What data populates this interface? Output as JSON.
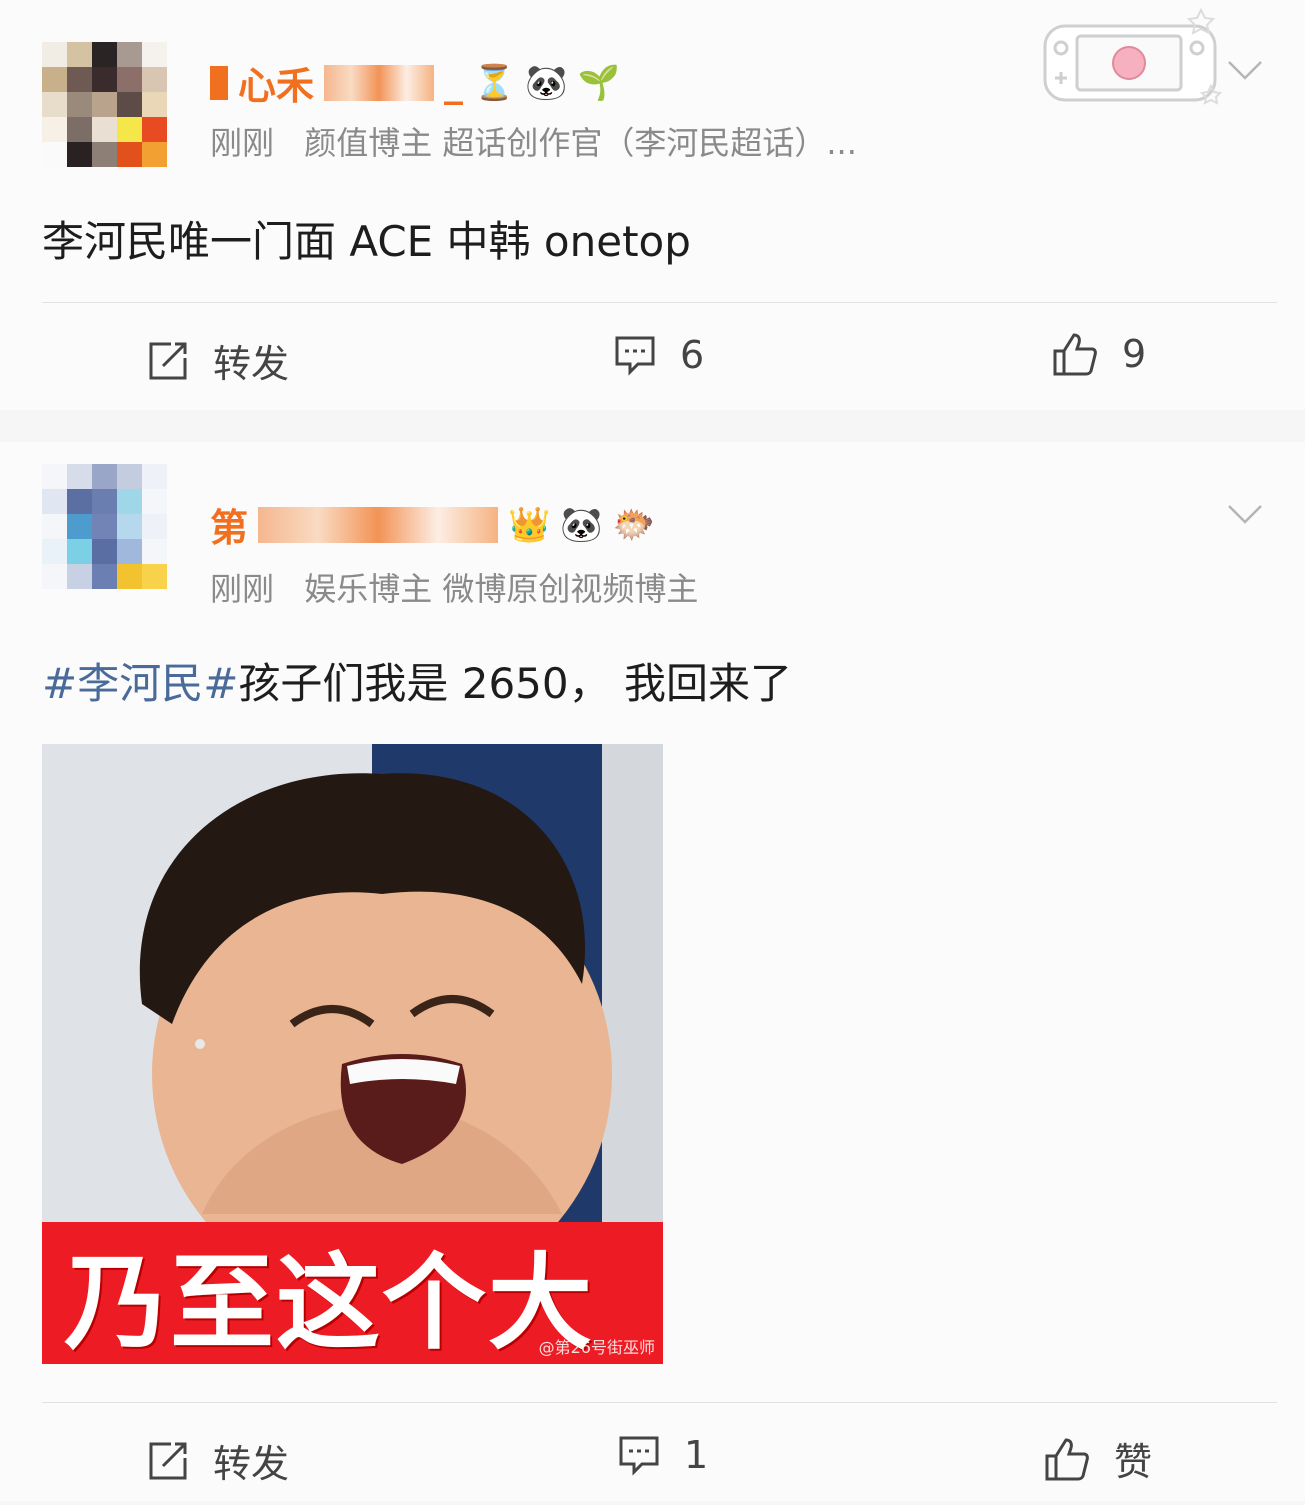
{
  "posts": [
    {
      "author": {
        "name_visible": "心禾",
        "name_end": "_",
        "badges": [
          "⏳",
          "🐼",
          "🌱"
        ]
      },
      "time": "刚刚",
      "tags": "颜值博主 超话创作官（李河民超话）...",
      "text": "李河民唯一门面 ACE 中韩 onetop",
      "actions": {
        "repost": "转发",
        "comments": "6",
        "likes": "9"
      }
    },
    {
      "author": {
        "name_visible": "第",
        "badges": [
          "👑",
          "🐼",
          "🐡"
        ]
      },
      "time": "刚刚",
      "tags": "娱乐博主 微博原创视频博主",
      "topic": "#李河民#",
      "text": "孩子们我是 2650， 我回来了",
      "image": {
        "caption": "乃至这个大",
        "watermark": "@第26号街巫师"
      },
      "actions": {
        "repost": "转发",
        "comments": "1",
        "likes": "赞"
      }
    }
  ],
  "colors": {
    "name": "#f07020",
    "topic": "#4a6b9a",
    "meme_band": "#ed1c24",
    "meta": "#8a8a8a"
  },
  "icons": [
    "repost-icon",
    "comment-icon",
    "like-icon",
    "chevron-down-icon",
    "game-console-decoration"
  ]
}
